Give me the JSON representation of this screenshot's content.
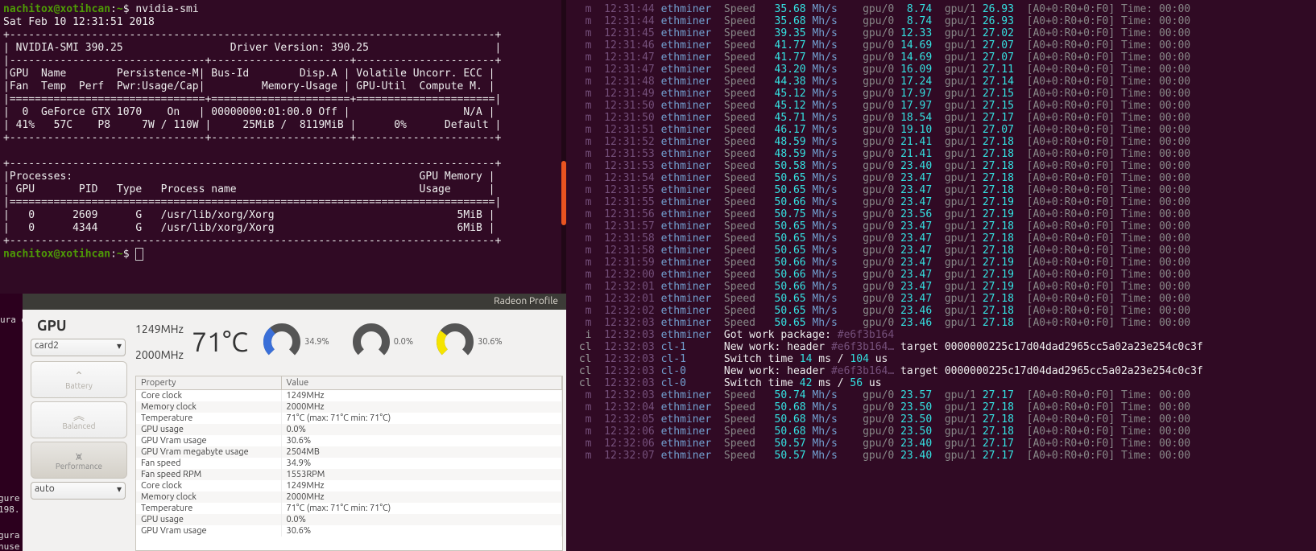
{
  "terminal": {
    "user": "nachitox",
    "host": "xotihcan",
    "path": "~",
    "command": "nvidia-smi",
    "date": "Sat Feb 10 12:31:51 2018",
    "smi_version": "NVIDIA-SMI 390.25",
    "driver_version": "Driver Version: 390.25",
    "hdr1": " GPU  Name        Persistence-M| Bus-Id        Disp.A | Volatile Uncorr. ECC |",
    "hdr2": " Fan  Temp  Perf  Pwr:Usage/Cap|         Memory-Usage | GPU-Util  Compute M. |",
    "row1": "   0  GeForce GTX 1070    On   | 00000000:01:00.0 Off |                  N/A |",
    "row2": "  41%   57C    P8     7W / 110W |     25MiB /  8119MiB |      0%      Default |",
    "proc_hdr": " Processes:                                                       GPU Memory |",
    "proc_hdr2": "  GPU       PID   Type   Process name                             Usage      |",
    "proc1": "    0      2609      G   /usr/lib/xorg/Xorg                             5MiB |",
    "proc2": "    0      4344      G   /usr/lib/xorg/Xorg                             6MiB |"
  },
  "radeon": {
    "title": "Radeon Profile",
    "gpu_label": "GPU",
    "card_sel": "card2",
    "auto_sel": "auto",
    "btn_battery": "Battery",
    "btn_balanced": "Balanced",
    "btn_performance": "Performance",
    "clock1": "1249MHz",
    "clock2": "2000MHz",
    "temp": "71°C",
    "g1": "34.9%",
    "g2": "0.0%",
    "g3": "30.6%",
    "col_prop": "Property",
    "col_val": "Value",
    "props": [
      [
        "Core clock",
        "1249MHz"
      ],
      [
        "Memory clock",
        "2000MHz"
      ],
      [
        "Temperature",
        "71°C (max: 71°C min: 71°C)"
      ],
      [
        "GPU usage",
        "0.0%"
      ],
      [
        "GPU Vram usage",
        "30.6%"
      ],
      [
        "GPU Vram megabyte usage",
        "2504MB"
      ],
      [
        "Fan speed",
        "34.9%"
      ],
      [
        "Fan speed RPM",
        "1553RPM"
      ],
      [
        "Core clock",
        "1249MHz"
      ],
      [
        "Memory clock",
        "2000MHz"
      ],
      [
        "Temperature",
        "71°C (max: 71°C min: 71°C)"
      ],
      [
        "GPU usage",
        "0.0%"
      ],
      [
        "GPU Vram usage",
        "30.6%"
      ]
    ]
  },
  "bgleft": {
    "f1": "ura d",
    "f2": "gure",
    "f3": "198.",
    "f4": "gura",
    "f5": "nuse"
  },
  "eth": {
    "tail": "[A0+0:R0+0:F0] Time: 00:00",
    "workpkg": "Got work package: #e6f3b164",
    "newwork": "New work: header #e6f3b164… target 0000000225c17d04dad2965cc5a02a23e254c0c3f",
    "switch1": "Switch time 14 ms / 104 us",
    "switch2": "Switch time 42 ms / 56 us",
    "rows": [
      [
        "m",
        "12:31:44",
        "ethminer",
        "35.68",
        "8.74",
        "26.93"
      ],
      [
        "m",
        "12:31:44",
        "ethminer",
        "35.68",
        "8.74",
        "26.93"
      ],
      [
        "m",
        "12:31:45",
        "ethminer",
        "39.35",
        "12.33",
        "27.02"
      ],
      [
        "m",
        "12:31:46",
        "ethminer",
        "41.77",
        "14.69",
        "27.07"
      ],
      [
        "m",
        "12:31:47",
        "ethminer",
        "41.77",
        "14.69",
        "27.07"
      ],
      [
        "m",
        "12:31:47",
        "ethminer",
        "43.20",
        "16.09",
        "27.11"
      ],
      [
        "m",
        "12:31:48",
        "ethminer",
        "44.38",
        "17.24",
        "27.14"
      ],
      [
        "m",
        "12:31:49",
        "ethminer",
        "45.12",
        "17.97",
        "27.15"
      ],
      [
        "m",
        "12:31:50",
        "ethminer",
        "45.12",
        "17.97",
        "27.15"
      ],
      [
        "m",
        "12:31:50",
        "ethminer",
        "45.71",
        "18.54",
        "27.17"
      ],
      [
        "m",
        "12:31:51",
        "ethminer",
        "46.17",
        "19.10",
        "27.07"
      ],
      [
        "m",
        "12:31:52",
        "ethminer",
        "48.59",
        "21.41",
        "27.18"
      ],
      [
        "m",
        "12:31:53",
        "ethminer",
        "48.59",
        "21.41",
        "27.18"
      ],
      [
        "m",
        "12:31:53",
        "ethminer",
        "50.58",
        "23.40",
        "27.18"
      ],
      [
        "m",
        "12:31:54",
        "ethminer",
        "50.65",
        "23.47",
        "27.18"
      ],
      [
        "m",
        "12:31:55",
        "ethminer",
        "50.65",
        "23.47",
        "27.18"
      ],
      [
        "m",
        "12:31:55",
        "ethminer",
        "50.66",
        "23.47",
        "27.19"
      ],
      [
        "m",
        "12:31:56",
        "ethminer",
        "50.75",
        "23.56",
        "27.19"
      ],
      [
        "m",
        "12:31:57",
        "ethminer",
        "50.65",
        "23.47",
        "27.18"
      ],
      [
        "m",
        "12:31:58",
        "ethminer",
        "50.65",
        "23.47",
        "27.18"
      ],
      [
        "m",
        "12:31:58",
        "ethminer",
        "50.65",
        "23.47",
        "27.18"
      ],
      [
        "m",
        "12:31:59",
        "ethminer",
        "50.66",
        "23.47",
        "27.19"
      ],
      [
        "m",
        "12:32:00",
        "ethminer",
        "50.66",
        "23.47",
        "27.19"
      ],
      [
        "m",
        "12:32:01",
        "ethminer",
        "50.66",
        "23.47",
        "27.19"
      ],
      [
        "m",
        "12:32:01",
        "ethminer",
        "50.65",
        "23.47",
        "27.18"
      ],
      [
        "m",
        "12:32:02",
        "ethminer",
        "50.65",
        "23.46",
        "27.18"
      ],
      [
        "m",
        "12:32:03",
        "ethminer",
        "50.65",
        "23.46",
        "27.18"
      ],
      [
        "i",
        "12:32:03",
        "ethminer",
        "WORKPKG",
        "",
        "",
        ""
      ],
      [
        "cl",
        "12:32:03",
        "cl-1",
        "NEWWORK",
        "",
        "",
        ""
      ],
      [
        "cl",
        "12:32:03",
        "cl-1",
        "SWITCH1",
        "",
        "",
        ""
      ],
      [
        "cl",
        "12:32:03",
        "cl-0",
        "NEWWORK",
        "",
        "",
        ""
      ],
      [
        "cl",
        "12:32:03",
        "cl-0",
        "SWITCH2",
        "",
        "",
        ""
      ],
      [
        "m",
        "12:32:03",
        "ethminer",
        "50.74",
        "23.57",
        "27.17"
      ],
      [
        "m",
        "12:32:04",
        "ethminer",
        "50.68",
        "23.50",
        "27.18"
      ],
      [
        "m",
        "12:32:05",
        "ethminer",
        "50.68",
        "23.50",
        "27.18"
      ],
      [
        "m",
        "12:32:06",
        "ethminer",
        "50.68",
        "23.50",
        "27.18"
      ],
      [
        "m",
        "12:32:06",
        "ethminer",
        "50.57",
        "23.40",
        "27.17"
      ],
      [
        "m",
        "12:32:07",
        "ethminer",
        "50.57",
        "23.40",
        "27.17"
      ]
    ]
  }
}
